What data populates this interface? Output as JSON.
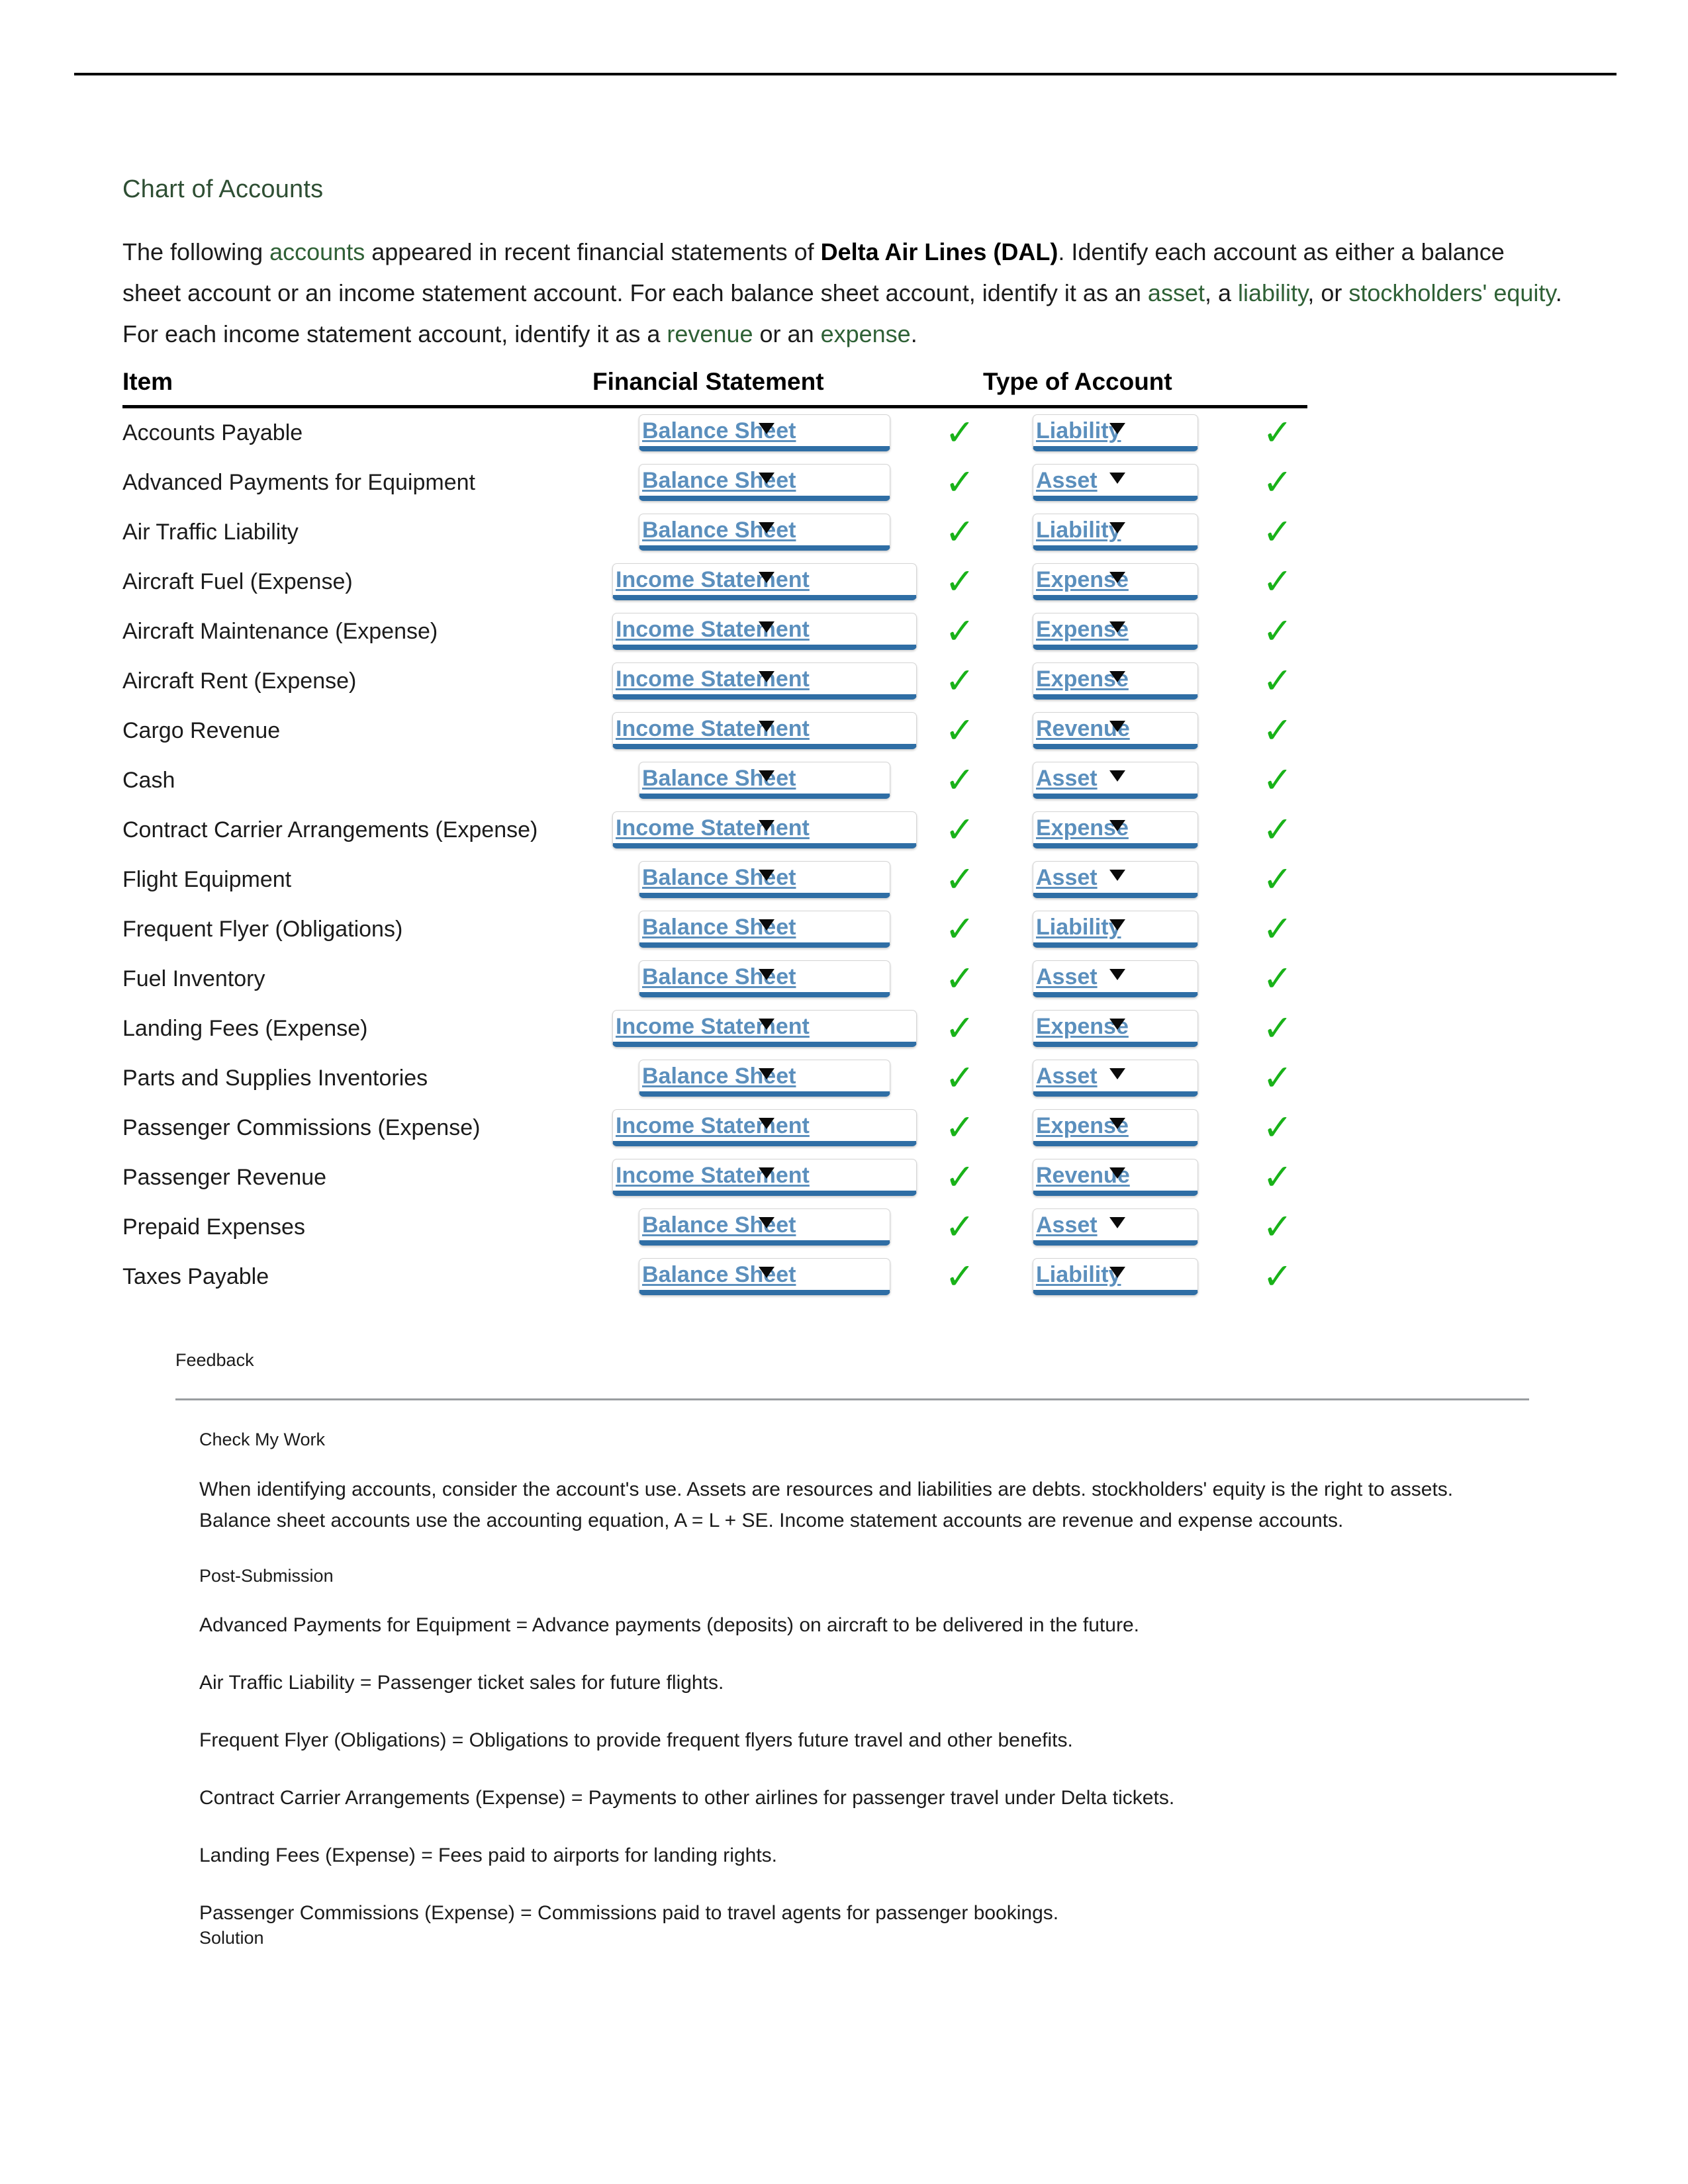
{
  "document": {
    "title": "Chart of Accounts",
    "intro": {
      "seg1": "The following ",
      "link1": "accounts",
      "seg2": " appeared in recent financial statements of ",
      "bold1": "Delta Air Lines (DAL)",
      "seg3": ". Identify each account as either a balance sheet account or an income statement account. For each balance sheet account, identify it as an ",
      "link2": "asset",
      "seg4": ", a ",
      "link3": "liability",
      "seg5": ", or ",
      "link4": "stockholders' equity",
      "seg6": ". For each income statement account, identify it as a ",
      "link5": "revenue",
      "seg7": " or an ",
      "link6": "expense",
      "seg8": "."
    }
  },
  "table": {
    "headers": {
      "item": "Item",
      "financial_statement": "Financial Statement",
      "type_of_account": "Type of Account"
    },
    "correct_mark": "✓",
    "rows": [
      {
        "item": "Accounts Payable",
        "statement": "Balance Sheet",
        "statement_correct": "✓",
        "type": "Liability",
        "type_correct": "✓"
      },
      {
        "item": "Advanced Payments for Equipment",
        "statement": "Balance Sheet",
        "statement_correct": "✓",
        "type": "Asset",
        "type_correct": "✓"
      },
      {
        "item": "Air Traffic Liability",
        "statement": "Balance Sheet",
        "statement_correct": "✓",
        "type": "Liability",
        "type_correct": "✓"
      },
      {
        "item": "Aircraft Fuel (Expense)",
        "statement": "Income Statement",
        "statement_correct": "✓",
        "type": "Expense",
        "type_correct": "✓"
      },
      {
        "item": "Aircraft Maintenance (Expense)",
        "statement": "Income Statement",
        "statement_correct": "✓",
        "type": "Expense",
        "type_correct": "✓"
      },
      {
        "item": "Aircraft Rent (Expense)",
        "statement": "Income Statement",
        "statement_correct": "✓",
        "type": "Expense",
        "type_correct": "✓"
      },
      {
        "item": "Cargo Revenue",
        "statement": "Income Statement",
        "statement_correct": "✓",
        "type": "Revenue",
        "type_correct": "✓"
      },
      {
        "item": "Cash",
        "statement": "Balance Sheet",
        "statement_correct": "✓",
        "type": "Asset",
        "type_correct": "✓"
      },
      {
        "item": "Contract Carrier Arrangements (Expense)",
        "statement": "Income Statement",
        "statement_correct": "✓",
        "type": "Expense",
        "type_correct": "✓"
      },
      {
        "item": "Flight Equipment",
        "statement": "Balance Sheet",
        "statement_correct": "✓",
        "type": "Asset",
        "type_correct": "✓"
      },
      {
        "item": "Frequent Flyer (Obligations)",
        "statement": "Balance Sheet",
        "statement_correct": "✓",
        "type": "Liability",
        "type_correct": "✓"
      },
      {
        "item": "Fuel Inventory",
        "statement": "Balance Sheet",
        "statement_correct": "✓",
        "type": "Asset",
        "type_correct": "✓"
      },
      {
        "item": "Landing Fees (Expense)",
        "statement": "Income Statement",
        "statement_correct": "✓",
        "type": "Expense",
        "type_correct": "✓"
      },
      {
        "item": "Parts and Supplies Inventories",
        "statement": "Balance Sheet",
        "statement_correct": "✓",
        "type": "Asset",
        "type_correct": "✓"
      },
      {
        "item": "Passenger Commissions (Expense)",
        "statement": "Income Statement",
        "statement_correct": "✓",
        "type": "Expense",
        "type_correct": "✓"
      },
      {
        "item": "Passenger Revenue",
        "statement": "Income Statement",
        "statement_correct": "✓",
        "type": "Revenue",
        "type_correct": "✓"
      },
      {
        "item": "Prepaid Expenses",
        "statement": "Balance Sheet",
        "statement_correct": "✓",
        "type": "Asset",
        "type_correct": "✓"
      },
      {
        "item": "Taxes Payable",
        "statement": "Balance Sheet",
        "statement_correct": "✓",
        "type": "Liability",
        "type_correct": "✓"
      }
    ]
  },
  "feedback": {
    "title": "Feedback",
    "check_my_work": {
      "title": "Check My Work",
      "text": "When identifying accounts, consider the account's use. Assets are resources and liabilities are debts. stockholders' equity is the right to assets. Balance sheet accounts use the accounting equation, A = L + SE. Income statement accounts are revenue and expense accounts."
    },
    "post_submission": {
      "title": "Post-Submission",
      "lines": [
        "Advanced Payments for Equipment = Advance payments (deposits) on aircraft to be delivered in the future.",
        "Air Traffic Liability = Passenger ticket sales for future flights.",
        "Frequent Flyer (Obligations) = Obligations to provide frequent flyers future travel and other benefits.",
        "Contract Carrier Arrangements (Expense) = Payments to other airlines for passenger travel under Delta tickets.",
        "Landing Fees (Expense) = Fees paid to airports for landing rights.",
        "Passenger Commissions (Expense) = Commissions paid to travel agents for passenger bookings."
      ]
    },
    "solution": {
      "title": "Solution"
    }
  },
  "colors": {
    "heading_green": "#2f4f34",
    "link_green": "#2f6136",
    "select_blue": "#5b8fbd",
    "select_underline_blue": "#2f6ea5",
    "check_green": "#19b219"
  }
}
